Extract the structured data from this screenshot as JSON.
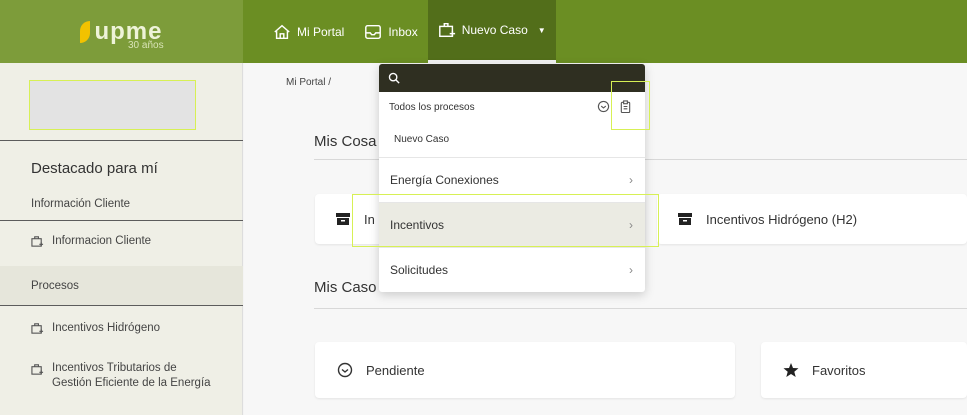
{
  "logo": {
    "name": "upme",
    "sub": "30 años"
  },
  "nav": [
    {
      "label": "Mi Portal",
      "icon": "home-icon"
    },
    {
      "label": "Inbox",
      "icon": "inbox-icon"
    },
    {
      "label": "Nuevo Caso",
      "icon": "new-case-icon",
      "active": true
    }
  ],
  "sidebar": {
    "title": "Destacado para mí",
    "items": [
      {
        "label": "Información Cliente",
        "icon": ""
      },
      {
        "label": "Informacion Cliente",
        "icon": "case-icon"
      },
      {
        "label": "Procesos",
        "icon": ""
      },
      {
        "label": "Incentivos Hidrógeno",
        "icon": "case-icon"
      },
      {
        "label": "Incentivos Tributarios de",
        "label2": "Gestión Eficiente de la Energía",
        "icon": "case-icon"
      }
    ]
  },
  "main": {
    "breadcrumb": "Mi Portal /",
    "mis_cosas": "Mis Cosa",
    "mis_casos": "Mis Caso",
    "cards_top": [
      {
        "label": "In",
        "icon": "archive-icon"
      },
      {
        "label": "Incentivos Hidrógeno (H2)",
        "icon": "archive-icon"
      }
    ],
    "cards_bottom": [
      {
        "label": "Pendiente",
        "icon": "clock-icon"
      },
      {
        "label": "Favoritos",
        "icon": "star-icon"
      }
    ]
  },
  "dropdown": {
    "search_placeholder": "",
    "header": "Todos los procesos",
    "sub": "Nuevo Caso",
    "items": [
      {
        "label": "Energía Conexiones"
      },
      {
        "label": "Incentivos",
        "highlighted": true
      },
      {
        "label": "Solicitudes"
      }
    ]
  },
  "colors": {
    "nav": "#6b8e23",
    "nav_active": "#526e1a",
    "search_bar": "#2f2f21",
    "highlight": "#d7f055"
  }
}
